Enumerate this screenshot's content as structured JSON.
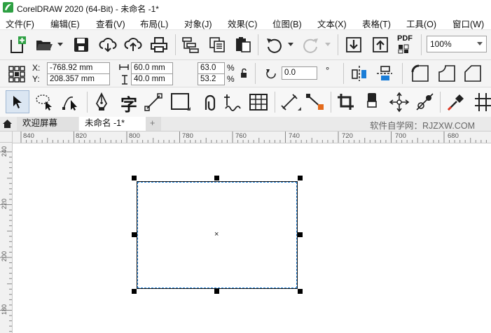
{
  "window": {
    "title": "CorelDRAW 2020 (64-Bit) - 未命名 -1*"
  },
  "menu": [
    "文件(F)",
    "编辑(E)",
    "查看(V)",
    "布局(L)",
    "对象(J)",
    "效果(C)",
    "位图(B)",
    "文本(X)",
    "表格(T)",
    "工具(O)",
    "窗口(W)"
  ],
  "toolbar": {
    "zoom": "100%",
    "pdf_label": "PDF"
  },
  "property_bar": {
    "x_label": "X:",
    "x_value": "-768.92 mm",
    "y_label": "Y:",
    "y_value": "208.357 mm",
    "width_value": "60.0 mm",
    "height_value": "40.0 mm",
    "scale_w": "63.0",
    "scale_h": "53.2",
    "percent": "%",
    "rotation": "0.0",
    "degree": "°"
  },
  "tabs": {
    "welcome": "欢迎屏幕",
    "document": "未命名 -1*",
    "add": "+",
    "watermark": "软件自学网：RJZXW.COM"
  },
  "ruler": {
    "top_ticks": [
      "840",
      "820",
      "800",
      "780",
      "760",
      "740",
      "720",
      "700",
      "680"
    ],
    "left_ticks": [
      "240",
      "220",
      "200",
      "180"
    ]
  },
  "colors": {
    "accent": "#1a7dd7",
    "logo": "#2ea043"
  }
}
